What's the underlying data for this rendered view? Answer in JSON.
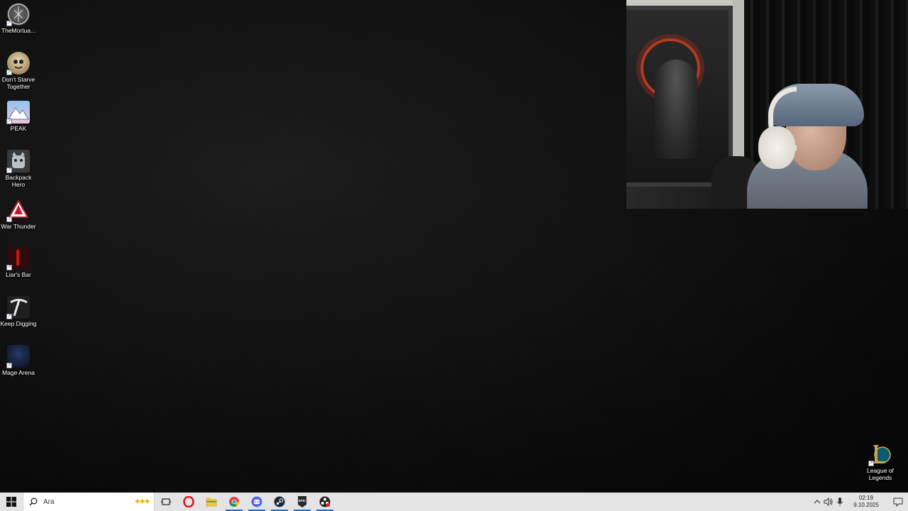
{
  "desktop": {
    "icons": [
      {
        "label": "TheMortua...",
        "icon": "mortuary-assistant-icon"
      },
      {
        "label": "Don't Starve Together",
        "icon": "dont-starve-together-icon"
      },
      {
        "label": "PEAK",
        "icon": "peak-icon"
      },
      {
        "label": "Backpack Hero",
        "icon": "backpack-hero-icon"
      },
      {
        "label": "War Thunder",
        "icon": "war-thunder-icon"
      },
      {
        "label": "Liar's Bar",
        "icon": "liars-bar-icon"
      },
      {
        "label": "Keep Digging",
        "icon": "keep-digging-icon"
      },
      {
        "label": "Mage Arena",
        "icon": "mage-arena-icon"
      }
    ],
    "bottom_right_icon": {
      "label": "League of Legends",
      "icon": "league-of-legends-icon"
    }
  },
  "webcam": {
    "description_icon": "webcam-overlay"
  },
  "taskbar": {
    "search_placeholder": "Ara",
    "pinned": [
      {
        "name": "task-view",
        "icon": "task-view-icon"
      },
      {
        "name": "opera",
        "icon": "opera-icon"
      },
      {
        "name": "file-explorer",
        "icon": "folder-icon"
      },
      {
        "name": "chrome",
        "icon": "chrome-icon"
      },
      {
        "name": "discord",
        "icon": "discord-icon"
      },
      {
        "name": "steam",
        "icon": "steam-icon"
      },
      {
        "name": "epic-games",
        "icon": "epic-games-icon"
      },
      {
        "name": "obs",
        "icon": "obs-icon"
      }
    ],
    "clock": {
      "time": "02:19",
      "date": "9.10.2025"
    }
  },
  "colors": {
    "taskbar_bg": "#e4e4e4",
    "active_indicator": "#1a73c9",
    "desktop_bg": "#0a0a0a"
  }
}
